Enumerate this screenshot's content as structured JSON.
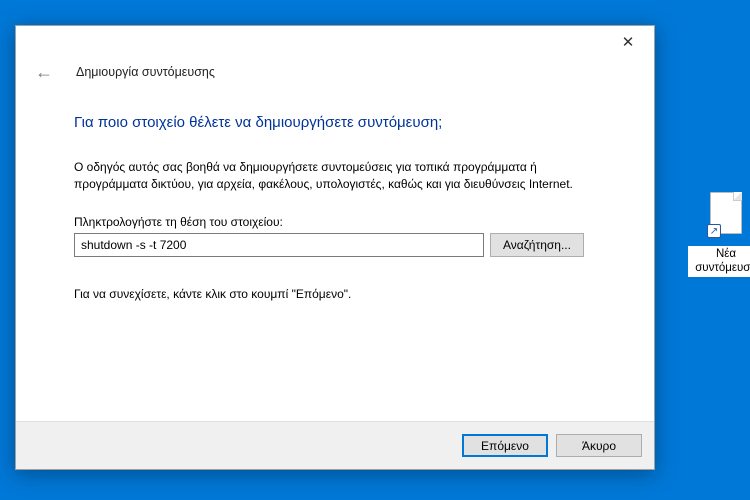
{
  "dialog": {
    "title": "Δημιουργία συντόμευσης",
    "heading": "Για ποιο στοιχείο θέλετε να δημιουργήσετε συντόμευση;",
    "description": "Ο οδηγός αυτός σας βοηθά να δημιουργήσετε συντομεύσεις για τοπικά προγράμματα ή προγράμματα δικτύου, για αρχεία, φακέλους, υπολογιστές, καθώς και για διευθύνσεις Internet.",
    "location_label": "Πληκτρολογήστε τη θέση του στοιχείου:",
    "location_value": "shutdown -s -t 7200",
    "browse_label": "Αναζήτηση...",
    "continue_text": "Για να συνεχίσετε, κάντε κλικ στο κουμπί \"Επόμενο\".",
    "next_label": "Επόμενο",
    "cancel_label": "Άκυρο"
  },
  "desktop": {
    "shortcut_label": "Νέα συντόμευση"
  }
}
